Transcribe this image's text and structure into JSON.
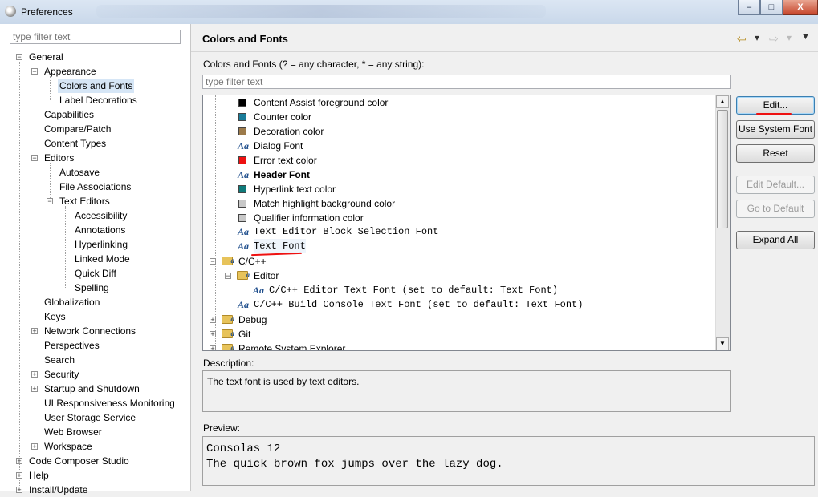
{
  "window": {
    "title": "Preferences",
    "controls": {
      "minimize": "–",
      "maximize": "□",
      "close": "X"
    }
  },
  "left_panel": {
    "filter_placeholder": "type filter text",
    "tree": [
      {
        "label": "General",
        "expander": "−"
      },
      {
        "label": "Appearance",
        "expander": "−"
      },
      {
        "label": "Colors and Fonts",
        "selected": true
      },
      {
        "label": "Label Decorations"
      },
      {
        "label": "Capabilities"
      },
      {
        "label": "Compare/Patch"
      },
      {
        "label": "Content Types"
      },
      {
        "label": "Editors",
        "expander": "−"
      },
      {
        "label": "Autosave"
      },
      {
        "label": "File Associations"
      },
      {
        "label": "Text Editors",
        "expander": "−"
      },
      {
        "label": "Accessibility"
      },
      {
        "label": "Annotations"
      },
      {
        "label": "Hyperlinking"
      },
      {
        "label": "Linked Mode"
      },
      {
        "label": "Quick Diff"
      },
      {
        "label": "Spelling"
      },
      {
        "label": "Globalization"
      },
      {
        "label": "Keys"
      },
      {
        "label": "Network Connections",
        "expander": "+"
      },
      {
        "label": "Perspectives"
      },
      {
        "label": "Search"
      },
      {
        "label": "Security",
        "expander": "+"
      },
      {
        "label": "Startup and Shutdown",
        "expander": "+"
      },
      {
        "label": "UI Responsiveness Monitoring"
      },
      {
        "label": "User Storage Service"
      },
      {
        "label": "Web Browser"
      },
      {
        "label": "Workspace",
        "expander": "+"
      },
      {
        "label": "Code Composer Studio",
        "expander": "+"
      },
      {
        "label": "Help",
        "expander": "+"
      },
      {
        "label": "Install/Update",
        "expander": "+"
      }
    ]
  },
  "main": {
    "page_title": "Colors and Fonts",
    "nav": {
      "back": "⇦",
      "back_menu": "▾",
      "forward": "⇨",
      "forward_menu": "▾",
      "view_menu": "▼"
    },
    "list_label": "Colors and Fonts (? = any character, * = any string):",
    "filter_placeholder": "type filter text",
    "items": [
      {
        "label": "Content Assist foreground color",
        "kind": "color",
        "color": "#000000"
      },
      {
        "label": "Counter color",
        "kind": "color",
        "color": "#1a7d9a"
      },
      {
        "label": "Decoration color",
        "kind": "color",
        "color": "#9c7a4a"
      },
      {
        "label": "Dialog Font",
        "kind": "font",
        "icon": "Aa"
      },
      {
        "label": "Error text color",
        "kind": "color",
        "color": "#ee1111"
      },
      {
        "label": "Header Font",
        "kind": "font",
        "icon": "Aa",
        "bold": true
      },
      {
        "label": "Hyperlink text color",
        "kind": "color",
        "color": "#0f7a7a"
      },
      {
        "label": "Match highlight background color",
        "kind": "color",
        "color": "#c8c8c8"
      },
      {
        "label": "Qualifier information color",
        "kind": "color",
        "color": "#c8c8c8"
      },
      {
        "label": "Text Editor Block Selection Font",
        "kind": "font",
        "icon": "Aa",
        "mono": true
      },
      {
        "label": "Text Font",
        "kind": "font",
        "icon": "Aa",
        "mono": true,
        "selected": true
      },
      {
        "label": "C/C++",
        "kind": "folder",
        "expander": "−"
      },
      {
        "label": "Editor",
        "kind": "folder",
        "expander": "−"
      },
      {
        "label": "C/C++ Editor Text Font (set to default: Text Font)",
        "kind": "font",
        "icon": "Aa",
        "mono": true
      },
      {
        "label": "C/C++ Build Console Text Font (set to default: Text Font)",
        "kind": "font",
        "icon": "Aa",
        "mono": true
      },
      {
        "label": "Debug",
        "kind": "folder",
        "expander": "+"
      },
      {
        "label": "Git",
        "kind": "folder",
        "expander": "+"
      },
      {
        "label": "Remote System Explorer",
        "kind": "folder",
        "expander": "+"
      }
    ],
    "scroll": {
      "up": "▲",
      "down": "▼"
    },
    "buttons": {
      "edit": "Edit...",
      "use_system_font": "Use System Font",
      "reset": "Reset",
      "edit_default": "Edit Default...",
      "go_to_default": "Go to Default",
      "expand_all": "Expand All"
    },
    "description_label": "Description:",
    "description_text": "The text font is used by text editors.",
    "preview_label": "Preview:",
    "preview_line1": "Consolas 12",
    "preview_line2": "The quick brown fox jumps over the lazy dog.",
    "annotation_color": "#ee1111"
  }
}
